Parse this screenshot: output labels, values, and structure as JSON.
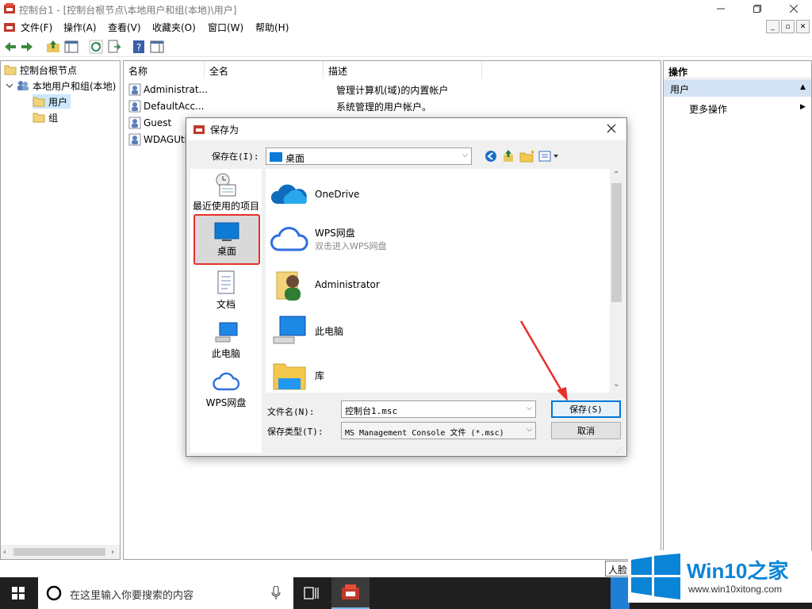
{
  "window": {
    "title": "控制台1 - [控制台根节点\\本地用户和组(本地)\\用户]",
    "menu": [
      "文件(F)",
      "操作(A)",
      "查看(V)",
      "收藏夹(O)",
      "窗口(W)",
      "帮助(H)"
    ]
  },
  "tree": {
    "root": "控制台根节点",
    "child": "本地用户和组(本地)",
    "items": [
      "用户",
      "组"
    ]
  },
  "list": {
    "columns": [
      "名称",
      "全名",
      "描述"
    ],
    "rows": [
      {
        "name": "Administrat...",
        "fullname": "",
        "desc": "管理计算机(域)的内置帐户"
      },
      {
        "name": "DefaultAcc...",
        "fullname": "",
        "desc": "系统管理的用户帐户。"
      },
      {
        "name": "Guest",
        "fullname": "",
        "desc": ""
      },
      {
        "name": "WDAGUti",
        "fullname": "",
        "desc": ""
      }
    ]
  },
  "actions": {
    "header": "操作",
    "section": "用户",
    "more": "更多操作"
  },
  "dialog": {
    "title": "保存为",
    "save_in_label": "保存在(I):",
    "save_in_value": "桌面",
    "places": [
      {
        "label": "最近使用的项目",
        "icon": "recent-icon"
      },
      {
        "label": "桌面",
        "icon": "desktop-icon",
        "selected": true
      },
      {
        "label": "文档",
        "icon": "document-icon"
      },
      {
        "label": "此电脑",
        "icon": "computer-icon"
      },
      {
        "label": "WPS网盘",
        "icon": "wps-cloud-icon"
      }
    ],
    "files": [
      {
        "name": "OneDrive",
        "sub": "",
        "icon": "onedrive-icon"
      },
      {
        "name": "WPS网盘",
        "sub": "双击进入WPS网盘",
        "icon": "wps-cloud-icon"
      },
      {
        "name": "Administrator",
        "sub": "",
        "icon": "user-folder-icon"
      },
      {
        "name": "此电脑",
        "sub": "",
        "icon": "computer-icon"
      },
      {
        "name": "库",
        "sub": "",
        "icon": "library-icon"
      }
    ],
    "filename_label": "文件名(N):",
    "filename_value": "控制台1.msc",
    "filetype_label": "保存类型(T):",
    "filetype_value": "MS Management Console 文件 (*.msc)",
    "save_button": "保存(S)",
    "cancel_button": "取消"
  },
  "taskbar": {
    "search_placeholder": "在这里输入你要搜索的内容",
    "tooltip_partial": "人脸"
  },
  "watermark": {
    "brand": "Win10之家",
    "url": "www.win10xitong.com"
  },
  "colors": {
    "accent": "#0078d7",
    "selection": "#cce8ff",
    "annotation_red": "#e8302a"
  }
}
